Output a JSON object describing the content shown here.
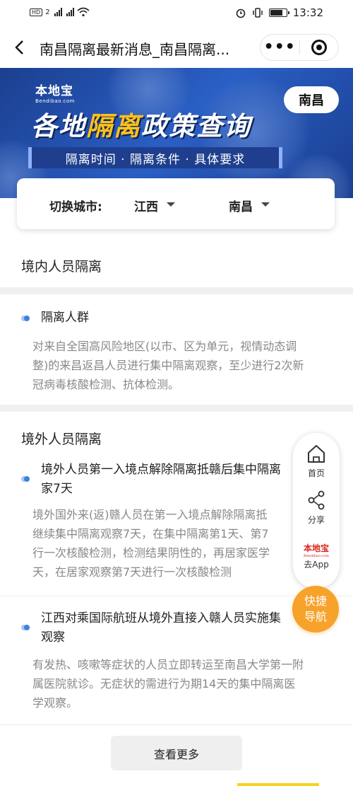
{
  "status_bar": {
    "left_indicators": "HD 2 4G 4G",
    "time": "13:32"
  },
  "title_bar": {
    "title": "南昌隔离最新消息_南昌隔离...",
    "more_label": "•••"
  },
  "banner": {
    "brand_name": "本地宝",
    "brand_domain": "Bendibao.com",
    "city": "南昌",
    "headline_prefix": "各地",
    "headline_highlight": "隔离",
    "headline_suffix": "政策查询",
    "subtitle": "隔离时间 · 隔离条件 · 具体要求"
  },
  "city_switch": {
    "label": "切换城市:",
    "province": "江西",
    "city": "南昌"
  },
  "sections": {
    "domestic": {
      "title": "境内人员隔离",
      "items": [
        {
          "title": "隔离人群",
          "body_lines": [
            "对来自全国高风险地区(以市、区为单元，视情动态调",
            "整)的来昌返昌人员进行集中隔离观察，至少进行2次新",
            "冠病毒核酸检测、抗体检测。"
          ]
        }
      ]
    },
    "overseas": {
      "title": "境外人员隔离",
      "items": [
        {
          "title_lines": [
            "境外人员第一入境点解除隔离抵赣后集中隔离",
            "家7天"
          ],
          "body_lines": [
            "境外国外来(返)赣人员在第一入境点解除隔离抵",
            "继续集中隔离观察7天，在集中隔离第1天、第7",
            "行一次核酸检测，检测结果阴性的，再居家医学",
            "天，在居家观察第7天进行一次核酸检测"
          ]
        },
        {
          "title_lines": [
            "江西对乘国际航班从境外直接入赣人员实施集",
            "观察"
          ],
          "body_lines": [
            "有发热、咳嗽等症状的人员立即转运至南昌大学第一附",
            "属医院就诊。无症状的需进行为期14天的集中隔离医",
            "学观察。"
          ]
        }
      ]
    }
  },
  "float_bar": {
    "home": "首页",
    "share": "分享",
    "app_logo": "本地宝",
    "app_logo_domain": "Bendibao.com",
    "app": "去App",
    "quick_nav_line1": "快捷",
    "quick_nav_line2": "导航"
  },
  "more_button": "查看更多",
  "colors": {
    "banner_blue": "#2a5fc4",
    "highlight_yellow": "#ffc21a",
    "quick_nav_orange": "#f7a22b",
    "bullet_blue": "#3f7fe0"
  }
}
